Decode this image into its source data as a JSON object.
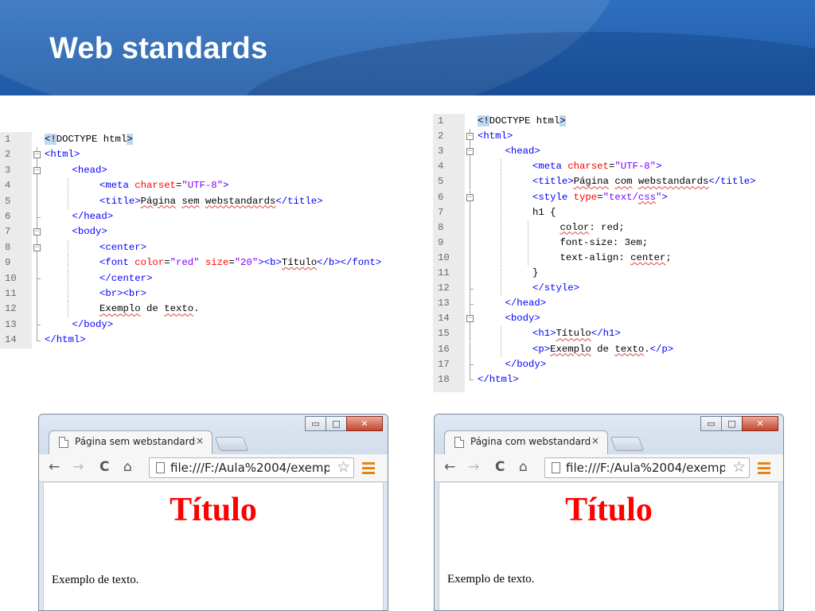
{
  "slide": {
    "title": "Web standards"
  },
  "left_code": {
    "lines": [
      {
        "n": "1",
        "indent": 0,
        "fold": "",
        "segs": [
          {
            "c": "hl",
            "t": "<!"
          },
          {
            "c": "tx",
            "t": "DOCTYPE html"
          },
          {
            "c": "hl",
            "t": ">"
          }
        ]
      },
      {
        "n": "2",
        "indent": 0,
        "fold": "open",
        "segs": [
          {
            "c": "t",
            "t": "<html>"
          }
        ]
      },
      {
        "n": "3",
        "indent": 1,
        "fold": "open",
        "segs": [
          {
            "c": "t",
            "t": "<head>"
          }
        ]
      },
      {
        "n": "4",
        "indent": 2,
        "fold": "line",
        "segs": [
          {
            "c": "t",
            "t": "<meta "
          },
          {
            "c": "a",
            "t": "charset"
          },
          {
            "c": "tx",
            "t": "="
          },
          {
            "c": "v",
            "t": "\"UTF-8\""
          },
          {
            "c": "t",
            "t": ">"
          }
        ]
      },
      {
        "n": "5",
        "indent": 2,
        "fold": "line",
        "segs": [
          {
            "c": "t",
            "t": "<title>"
          },
          {
            "c": "tx sq",
            "t": "Página"
          },
          {
            "c": "tx",
            "t": " "
          },
          {
            "c": "tx sq",
            "t": "sem"
          },
          {
            "c": "tx",
            "t": " "
          },
          {
            "c": "tx sq",
            "t": "webstandards"
          },
          {
            "c": "t",
            "t": "</title>"
          }
        ]
      },
      {
        "n": "6",
        "indent": 1,
        "fold": "end",
        "segs": [
          {
            "c": "t",
            "t": "</head>"
          }
        ]
      },
      {
        "n": "7",
        "indent": 1,
        "fold": "open",
        "segs": [
          {
            "c": "t",
            "t": "<body>"
          }
        ]
      },
      {
        "n": "8",
        "indent": 2,
        "fold": "open",
        "segs": [
          {
            "c": "t",
            "t": "<center>"
          }
        ]
      },
      {
        "n": "9",
        "indent": 2,
        "fold": "line",
        "segs": [
          {
            "c": "t",
            "t": "<font "
          },
          {
            "c": "a",
            "t": "color"
          },
          {
            "c": "tx",
            "t": "="
          },
          {
            "c": "v",
            "t": "\"red\""
          },
          {
            "c": "tx",
            "t": " "
          },
          {
            "c": "a",
            "t": "size"
          },
          {
            "c": "tx",
            "t": "="
          },
          {
            "c": "v",
            "t": "\"20\""
          },
          {
            "c": "t",
            "t": "><b>"
          },
          {
            "c": "tx sq",
            "t": "Título"
          },
          {
            "c": "t",
            "t": "</b></font>"
          }
        ]
      },
      {
        "n": "10",
        "indent": 2,
        "fold": "end",
        "segs": [
          {
            "c": "t",
            "t": "</center>"
          }
        ]
      },
      {
        "n": "11",
        "indent": 2,
        "fold": "line",
        "segs": [
          {
            "c": "t",
            "t": "<br><br>"
          }
        ]
      },
      {
        "n": "12",
        "indent": 2,
        "fold": "line",
        "segs": [
          {
            "c": "tx sq",
            "t": "Exemplo"
          },
          {
            "c": "tx",
            "t": " de "
          },
          {
            "c": "tx sq",
            "t": "texto"
          },
          {
            "c": "tx",
            "t": "."
          }
        ]
      },
      {
        "n": "13",
        "indent": 1,
        "fold": "end",
        "segs": [
          {
            "c": "t",
            "t": "</body>"
          }
        ]
      },
      {
        "n": "14",
        "indent": 0,
        "fold": "end",
        "segs": [
          {
            "c": "t",
            "t": "</html>"
          }
        ]
      }
    ]
  },
  "right_code": {
    "lines": [
      {
        "n": "1",
        "indent": 0,
        "fold": "",
        "segs": [
          {
            "c": "hl",
            "t": "<!"
          },
          {
            "c": "tx",
            "t": "DOCTYPE html"
          },
          {
            "c": "hl",
            "t": ">"
          }
        ]
      },
      {
        "n": "2",
        "indent": 0,
        "fold": "open",
        "segs": [
          {
            "c": "t",
            "t": "<html>"
          }
        ]
      },
      {
        "n": "3",
        "indent": 1,
        "fold": "open",
        "segs": [
          {
            "c": "t",
            "t": "<head>"
          }
        ]
      },
      {
        "n": "4",
        "indent": 2,
        "fold": "line",
        "segs": [
          {
            "c": "t",
            "t": "<meta "
          },
          {
            "c": "a",
            "t": "charset"
          },
          {
            "c": "tx",
            "t": "="
          },
          {
            "c": "v",
            "t": "\"UTF-8\""
          },
          {
            "c": "t",
            "t": ">"
          }
        ]
      },
      {
        "n": "5",
        "indent": 2,
        "fold": "line",
        "segs": [
          {
            "c": "t",
            "t": "<title>"
          },
          {
            "c": "tx sq",
            "t": "Página"
          },
          {
            "c": "tx",
            "t": " "
          },
          {
            "c": "tx sq",
            "t": "com"
          },
          {
            "c": "tx",
            "t": " "
          },
          {
            "c": "tx sq",
            "t": "webstandards"
          },
          {
            "c": "t",
            "t": "</title>"
          }
        ]
      },
      {
        "n": "6",
        "indent": 2,
        "fold": "open",
        "segs": [
          {
            "c": "t",
            "t": "<style "
          },
          {
            "c": "a",
            "t": "type"
          },
          {
            "c": "tx",
            "t": "="
          },
          {
            "c": "v",
            "t": "\"text/"
          },
          {
            "c": "v sq",
            "t": "css"
          },
          {
            "c": "v",
            "t": "\""
          },
          {
            "c": "t",
            "t": ">"
          }
        ]
      },
      {
        "n": "7",
        "indent": 2,
        "fold": "line",
        "segs": [
          {
            "c": "tx",
            "t": "h1 {"
          }
        ]
      },
      {
        "n": "8",
        "indent": 3,
        "fold": "line",
        "segs": [
          {
            "c": "tx sq",
            "t": "color"
          },
          {
            "c": "tx",
            "t": ": red;"
          }
        ]
      },
      {
        "n": "9",
        "indent": 3,
        "fold": "line",
        "segs": [
          {
            "c": "tx",
            "t": "font-size: 3em;"
          }
        ]
      },
      {
        "n": "10",
        "indent": 3,
        "fold": "line",
        "segs": [
          {
            "c": "tx",
            "t": "text-align: "
          },
          {
            "c": "tx sq",
            "t": "center"
          },
          {
            "c": "tx",
            "t": ";"
          }
        ]
      },
      {
        "n": "11",
        "indent": 2,
        "fold": "line",
        "segs": [
          {
            "c": "tx",
            "t": "}"
          }
        ]
      },
      {
        "n": "12",
        "indent": 2,
        "fold": "end",
        "segs": [
          {
            "c": "t",
            "t": "</style>"
          }
        ]
      },
      {
        "n": "13",
        "indent": 1,
        "fold": "end",
        "segs": [
          {
            "c": "t",
            "t": "</head>"
          }
        ]
      },
      {
        "n": "14",
        "indent": 1,
        "fold": "open",
        "segs": [
          {
            "c": "t",
            "t": "<body>"
          }
        ]
      },
      {
        "n": "15",
        "indent": 2,
        "fold": "line",
        "segs": [
          {
            "c": "t",
            "t": "<h1>"
          },
          {
            "c": "tx sq",
            "t": "Título"
          },
          {
            "c": "t",
            "t": "</h1>"
          }
        ]
      },
      {
        "n": "16",
        "indent": 2,
        "fold": "line",
        "segs": [
          {
            "c": "t",
            "t": "<p>"
          },
          {
            "c": "tx sq",
            "t": "Exemplo"
          },
          {
            "c": "tx",
            "t": " de "
          },
          {
            "c": "tx sq",
            "t": "texto"
          },
          {
            "c": "tx",
            "t": "."
          },
          {
            "c": "t",
            "t": "</p>"
          }
        ]
      },
      {
        "n": "17",
        "indent": 1,
        "fold": "end",
        "segs": [
          {
            "c": "t",
            "t": "</body>"
          }
        ]
      },
      {
        "n": "18",
        "indent": 0,
        "fold": "end",
        "segs": [
          {
            "c": "t",
            "t": "</html>"
          }
        ]
      }
    ]
  },
  "browser_left": {
    "tab_title": "Página sem webstandards",
    "tab_close": "×",
    "address": "file:///F:/Aula%2004/exemp",
    "heading": "Título",
    "paragraph": "Exemplo de texto."
  },
  "browser_right": {
    "tab_title": "Página com webstandards",
    "tab_close": "×",
    "address": "file:///F:/Aula%2004/exemp",
    "heading": "Título",
    "paragraph": "Exemplo de texto."
  },
  "icons": {
    "back": "←",
    "forward": "→",
    "reload": "C",
    "home": "⌂",
    "star": "☆",
    "minimize": "▭",
    "maximize": "□",
    "close": "✕"
  },
  "colors": {
    "tag": "#0000ff",
    "attribute": "#ff0000",
    "value": "#8000ff",
    "heading": "#ff0000"
  }
}
